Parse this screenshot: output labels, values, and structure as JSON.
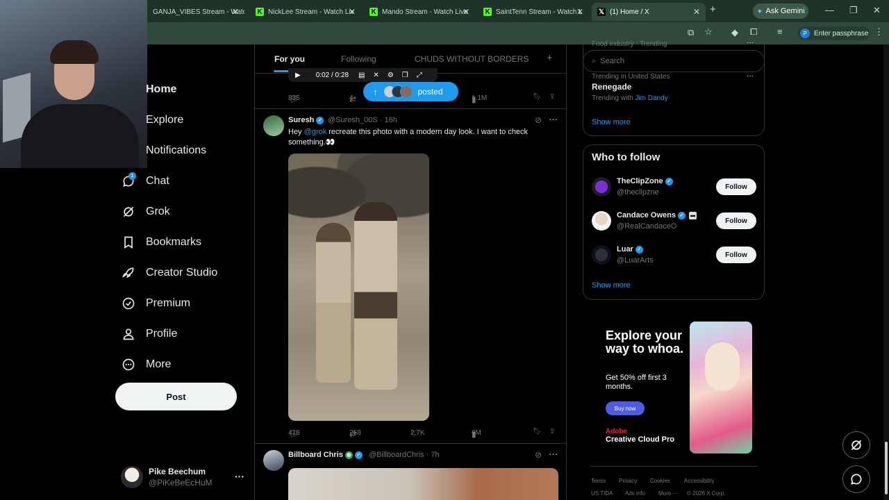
{
  "browser": {
    "tabs": [
      {
        "label": "GANJA_VIBES Stream - Watc",
        "icon": "kick-icon"
      },
      {
        "label": "NickLee Stream - Watch Liv",
        "icon": "kick-icon"
      },
      {
        "label": "Mando Stream - Watch Live",
        "icon": "kick-icon"
      },
      {
        "label": "SaintTenn Stream - Watch L",
        "icon": "kick-icon"
      },
      {
        "label": "(1) Home / X",
        "icon": "x-logo-icon"
      }
    ],
    "ask_gemini": "Ask Gemini",
    "profile_initial": "P",
    "passphrase": "Enter passphrase"
  },
  "nav": {
    "items": [
      {
        "label": "Home",
        "icon": "home-icon"
      },
      {
        "label": "Explore",
        "icon": "search-icon"
      },
      {
        "label": "Notifications",
        "icon": "bell-icon"
      },
      {
        "label": "Chat",
        "icon": "chat-icon"
      },
      {
        "label": "Grok",
        "icon": "grok-icon"
      },
      {
        "label": "Bookmarks",
        "icon": "bookmark-icon"
      },
      {
        "label": "Creator Studio",
        "icon": "rocket-icon"
      },
      {
        "label": "Premium",
        "icon": "verified-icon"
      },
      {
        "label": "Profile",
        "icon": "person-icon"
      },
      {
        "label": "More",
        "icon": "more-circle-icon"
      }
    ],
    "chat_badge": "1",
    "post_label": "Post",
    "account": {
      "name": "Pike Beechum",
      "handle": "@PiKeBeEcHuM"
    }
  },
  "feed": {
    "tabs": [
      "For you",
      "Following",
      "CHUDS WITHOUT BORDERS"
    ],
    "active_tab": "For you",
    "mini_player_time": "0:02 / 0:28",
    "posted_label": "posted",
    "prev_actions": {
      "replies": "835",
      "reposts": "4",
      "views": "1.1M"
    },
    "tweet1": {
      "name": "Suresh",
      "handle": "@Suresh_00S",
      "time": "· 16h",
      "text_before": "Hey ",
      "mention": "@grok",
      "text_after": " recreate this photo with a modern day look. I want to check something.👀",
      "replies": "418",
      "reposts": "258",
      "likes": "2.7K",
      "views": "6M"
    },
    "tweet2": {
      "name": "Billboard Chris",
      "handle": "@BillboardChris",
      "time": "· 7h"
    }
  },
  "sidebar": {
    "search_placeholder": "Search",
    "trend_partial": "Food industry · Trending",
    "trend_location": "Trending in United States",
    "trend_title": "Renegade",
    "trend_with_label": "Trending with",
    "trend_with_link": "Jim Dandy",
    "show_more": "Show more",
    "who_to_follow": "Who to follow",
    "suggestions": [
      {
        "name": "TheClipZone",
        "handle": "@theclipzne",
        "follow": "Follow"
      },
      {
        "name": "Candace Owens",
        "handle": "@RealCandaceO",
        "follow": "Follow"
      },
      {
        "name": "Luar",
        "handle": "@LuarArts",
        "follow": "Follow"
      }
    ],
    "ad": {
      "headline": "Explore your way to whoa.",
      "offer": "Get 50% off first 3 months.",
      "cta": "Buy now",
      "brand": "Adobe",
      "product": "Creative Cloud Pro"
    },
    "footer": [
      "Terms",
      "Privacy",
      "Cookies",
      "Accessibility",
      "US TIDA",
      "Ads info",
      "More ···",
      "© 2026 X Corp."
    ]
  },
  "colors": {
    "accent": "#1d9bf0",
    "background": "#000000",
    "chrome": "#2f4a3d"
  }
}
